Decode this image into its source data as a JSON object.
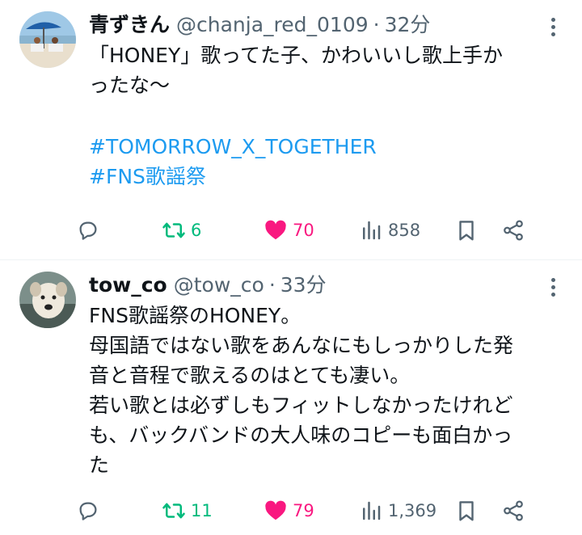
{
  "tweets": [
    {
      "name": "青ずきん",
      "handle": "@chanja_red_0109",
      "time": "32分",
      "text": "「HONEY」歌ってた子、かわいいし歌上手か\nったな〜",
      "hashtags": [
        "#TOMORROW_X_TOGETHER",
        "#FNS歌謡祭"
      ],
      "retweets": "6",
      "likes": "70",
      "views": "858"
    },
    {
      "name": "tow_co",
      "handle": "@tow_co",
      "time": "33分",
      "text": "FNS歌謡祭のHONEY。\n母国語ではない歌をあんなにもしっかりした発\n音と音程で歌えるのはとても凄い。\n若い歌とは必ずしもフィットしなかったけれど\nも、バックバンドの大人味のコピーも面白かっ\nた",
      "hashtags": [],
      "retweets": "11",
      "likes": "79",
      "views": "1,369"
    }
  ],
  "separator": "·",
  "colors": {
    "retweet": "#00ba7c",
    "like": "#f91880",
    "hashtag": "#1d9bf0",
    "muted": "#536471"
  },
  "icons": [
    "reply-icon",
    "retweet-icon",
    "like-icon",
    "views-icon",
    "bookmark-icon",
    "share-icon",
    "more-icon"
  ]
}
